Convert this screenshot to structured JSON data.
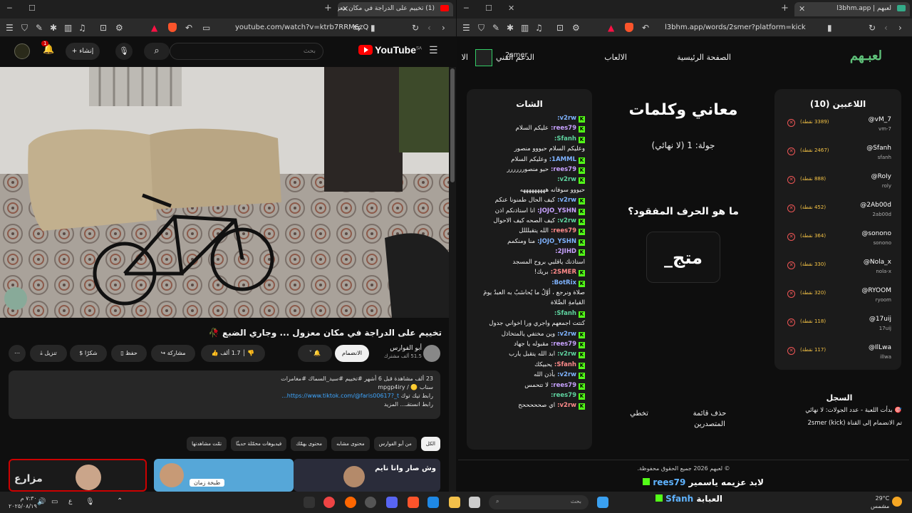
{
  "left_window": {
    "tab_title": "(1) تخييم على الدراجة في مكان معزول",
    "url": "youtube.com/watch?v=ktrb7RRM6zQ",
    "youtube": {
      "logo": "YouTube",
      "region": "SA",
      "search_placeholder": "بحث",
      "create_label": "إنشاء",
      "notif_count": "1",
      "video_title": "تخييم على الدراجة في مكان معزول ... وجاري الضبع 🥀",
      "channel_name": "أبو الفوارس",
      "subscribers": "51.5 ألف مشترك",
      "subscribe_label": "الانضمام",
      "likes": "1.7 ألف",
      "share_label": "مشاركة",
      "save_label": "حفظ",
      "thanks_label": "شكرًا",
      "download_label": "تنزيل",
      "description": {
        "line1": "23 ألف مشاهدة قبل 6 أشهر #تخييم #سيد_السماك #مغامرات",
        "line2": "سناب 🟡 / mpgp4iry",
        "line3_prefix": "رابط تيك توك ",
        "line3_link": "https://www.tiktok.com/@faris00617?_t...",
        "more": "رابط انستقـ... المزيد"
      },
      "chips": [
        "الكل",
        "من أبو الفوارس",
        "محتوى مشابه",
        "محتوى يهمّك",
        "فيديوهات محمّلة حديثًا",
        "تمّت مشاهدتها"
      ],
      "thumb_labels": [
        "طبخة زمان",
        "وش صار وانا نايم",
        "مزارع"
      ]
    }
  },
  "right_window": {
    "tab_title": "لعبهم | l3bhm.app",
    "url": "l3bhm.app/words/2smer?platform=kick",
    "site": {
      "brand": "لعبـهم",
      "nav": [
        "الصفحة الرئيسية",
        "الالعاب",
        "الدعم الفني",
        "الا"
      ],
      "user": "2smer",
      "game_title": "معاني وكلمات",
      "round": "جولة: 1 (لا نهائي)",
      "question": "ما هو الحرف المفقود؟",
      "word": "متج_",
      "skip_label": "تخطي",
      "delete_leaders_label": "حذف قائمة المتصدرين",
      "players_title": "اللاعبين (10)",
      "players": [
        {
          "handle": "@vM_7",
          "login": "vm-7",
          "points": "(3389 نقطة)"
        },
        {
          "handle": "@Sfanh",
          "login": "sfanh",
          "points": "(2467 نقطة)"
        },
        {
          "handle": "@RoIy",
          "login": "roly",
          "points": "(888 نقطة)"
        },
        {
          "handle": "@2Ab00d",
          "login": "2ab00d",
          "points": "(452 نقطة)"
        },
        {
          "handle": "@sonono",
          "login": "sonono",
          "points": "(364 نقطة)"
        },
        {
          "handle": "@Nola_x",
          "login": "nola-x",
          "points": "(330 نقطة)"
        },
        {
          "handle": "@RYOOM",
          "login": "ryoom",
          "points": "(320 نقطة)"
        },
        {
          "handle": "@17uij",
          "login": "17uij",
          "points": "(118 نقطة)"
        },
        {
          "handle": "@IlLwa",
          "login": "illwa",
          "points": "(117 نقطة)"
        }
      ],
      "chat_title": "الشات",
      "chat": [
        {
          "u": "v2rw:",
          "m": ""
        },
        {
          "u": "rees79:",
          "m": "عليكم السلام"
        },
        {
          "u": "Sfanh:",
          "m": ""
        },
        {
          "u": "",
          "m": "وعليكم السلام حيووو منصور"
        },
        {
          "u": "1AMML:",
          "m": "وعليكم السلام"
        },
        {
          "u": "rees79:",
          "m": "حيو منصورررررر"
        },
        {
          "u": "v2rw:",
          "m": ""
        },
        {
          "u": "",
          "m": "حيووو سوفانه هههههههههه"
        },
        {
          "u": "v2rw:",
          "m": "كيف الحال طمنونا عنكم"
        },
        {
          "u": "JOJO_YSHN:",
          "m": "انا استاذنكم اذن"
        },
        {
          "u": "v2rw:",
          "m": "كيف الصحه كيف الاحوال"
        },
        {
          "u": "rees79:",
          "m": "الله يتقبلللل"
        },
        {
          "u": "JOJO_YSHN:",
          "m": "منا ومنكمم"
        },
        {
          "u": "2JIHD:",
          "m": ""
        },
        {
          "u": "",
          "m": "استاذنك ياقلبي بروح المسجد"
        },
        {
          "u": "2SMER:",
          "m": "بريك!"
        },
        {
          "u": "BotRix:",
          "m": ""
        },
        {
          "u": "",
          "m": "صلاة ونرجع ، أوَّلُ ما يُحاسَبُ به العبدُ يومَ القيامةِ الصَّلاة"
        },
        {
          "u": "Sfanh:",
          "m": ""
        },
        {
          "u": "",
          "m": "كنتت اجمعهم واجري ورا اخواني جدول"
        },
        {
          "u": "v2rw:",
          "m": "وين مختفي يالمتخاذل"
        },
        {
          "u": "rees79:",
          "m": "مقبوله يا جهاد"
        },
        {
          "u": "v2rw:",
          "m": "ابد الله يتقبل يارب"
        },
        {
          "u": "Sfanh:",
          "m": "يحبيكك"
        },
        {
          "u": "v2rw:",
          "m": "بأذن الله"
        },
        {
          "u": "rees79:",
          "m": "لا تتحمس"
        },
        {
          "u": "rees79:",
          "m": ""
        },
        {
          "u": "v2rw:",
          "m": "اي صحححححح"
        }
      ],
      "log_title": "السجل",
      "log_entries": [
        "🎯 بدأت اللعبة - عدد الجولات: لا نهائي",
        "تم الانضمام إلى القناة 2smer (kick)"
      ],
      "footer": "© لعبهم 2026 جميع الحقوق محفوظة."
    },
    "overlay": {
      "line1_user": "rees79",
      "line1_msg": "لابد عزيمه ياسمير",
      "line2_user": "Sfanh",
      "line2_msg": "العبابة"
    }
  },
  "taskbar": {
    "search": "بحث",
    "weather_temp": "29°C",
    "weather_desc": "مشمس",
    "time": "٧:٣٠ م",
    "date": "٢٠٢٥/٠٨/١٩",
    "lang": "ع"
  }
}
